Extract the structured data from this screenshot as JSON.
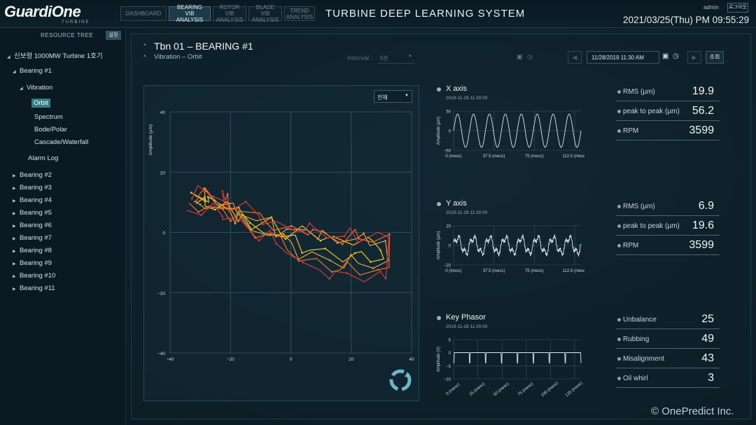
{
  "app": {
    "logo_text": "GuardiOne",
    "logo_sub": "TURBINE",
    "system_title": "TURBINE DEEP LEARNING SYSTEM",
    "user": "admin",
    "logout_label": "로그아웃",
    "datetime": "2021/03/25(Thu) PM 09:55:29",
    "copyright": "© OnePredict Inc."
  },
  "nav_tabs": [
    {
      "label": "DASHBOARD",
      "active": false
    },
    {
      "label": "BEARING VIB\nANALYSIS",
      "active": true
    },
    {
      "label": "ROTOR VIB\nANALYSIS",
      "active": false
    },
    {
      "label": "BLADE VIB\nANALYSIS",
      "active": false
    },
    {
      "label": "TREND\nANALYSIS",
      "active": false
    }
  ],
  "sidebar": {
    "title": "RESOURCE TREE",
    "settings_label": "설정",
    "root": "신보령 1000MW Turbine 1호기",
    "bearing1": "Bearing #1",
    "vibration": "Vibration",
    "vib_children": [
      "Orbit",
      "Spectrum",
      "Bode/Polar",
      "Cascade/Waterfall"
    ],
    "alarm_log": "Alarm Log",
    "bearings": [
      "Bearing #2",
      "Bearing #3",
      "Bearing #4",
      "Bearing #5",
      "Bearing #6",
      "Bearing #7",
      "Bearing #8",
      "Bearing #9",
      "Bearing #10",
      "Bearing #11"
    ]
  },
  "header": {
    "title": "Tbn 01 – BEARING #1",
    "subtitle": "Vibration – Orbit",
    "interval_label": "Interval :",
    "interval_value": "5분",
    "date_value": "11/28/2019 11:30 AM",
    "search_label": "조회"
  },
  "orbit": {
    "select_value": "전체",
    "y_label": "Amplitude (µm)",
    "x_ticks": [
      "−40",
      "−20",
      "0",
      "20",
      "40"
    ],
    "y_ticks": [
      "40",
      "20",
      "0",
      "−20",
      "−40"
    ],
    "colors": [
      "#f2c62c",
      "#e8a33a",
      "#f06d3a",
      "#d83a3a"
    ]
  },
  "x_axis": {
    "title": "X axis",
    "time": "2019-11-28 11:30:00",
    "y_label": "Amplitude (µm)",
    "y_ticks": [
      "50",
      "0",
      "−50"
    ],
    "x_ticks": [
      "0 (mesc)",
      "37.5 (mesc)",
      "75 (mesc)",
      "112.5\n(mesc)"
    ],
    "metrics": [
      {
        "label": "RMS (µm)",
        "value": "19.9"
      },
      {
        "label": "peak to peak (µm)",
        "value": "56.2"
      },
      {
        "label": "RPM",
        "value": "3599"
      }
    ]
  },
  "y_axis": {
    "title": "Y axis",
    "time": "2019-11-28 11:30:00",
    "y_label": "Amplitude (µm)",
    "y_ticks": [
      "20",
      "0",
      "−20"
    ],
    "x_ticks": [
      "0 (mesc)",
      "37.5 (mesc)",
      "75 (mesc)",
      "112.5\n(mesc)"
    ],
    "metrics": [
      {
        "label": "RMS (µm)",
        "value": "6.9"
      },
      {
        "label": "peak to peak (µm)",
        "value": "19.6"
      },
      {
        "label": "RPM",
        "value": "3599"
      }
    ]
  },
  "key_phasor": {
    "title": "Key Phasor",
    "time": "2019-11-28 11:30:00",
    "y_label": "Amplitude\n(V)",
    "y_ticks": [
      "5",
      "0",
      "−5",
      "−10"
    ],
    "x_ticks": [
      "0 (mesc)",
      "25 (mesc)",
      "50 (mesc)",
      "75 (mesc)",
      "100 (mesc)",
      "125 (mesc)"
    ],
    "metrics": [
      {
        "label": "Unbalance",
        "value": "25"
      },
      {
        "label": "Rubbing",
        "value": "49"
      },
      {
        "label": "Misalignment",
        "value": "43"
      },
      {
        "label": "Oil whirl",
        "value": "3"
      }
    ]
  }
}
